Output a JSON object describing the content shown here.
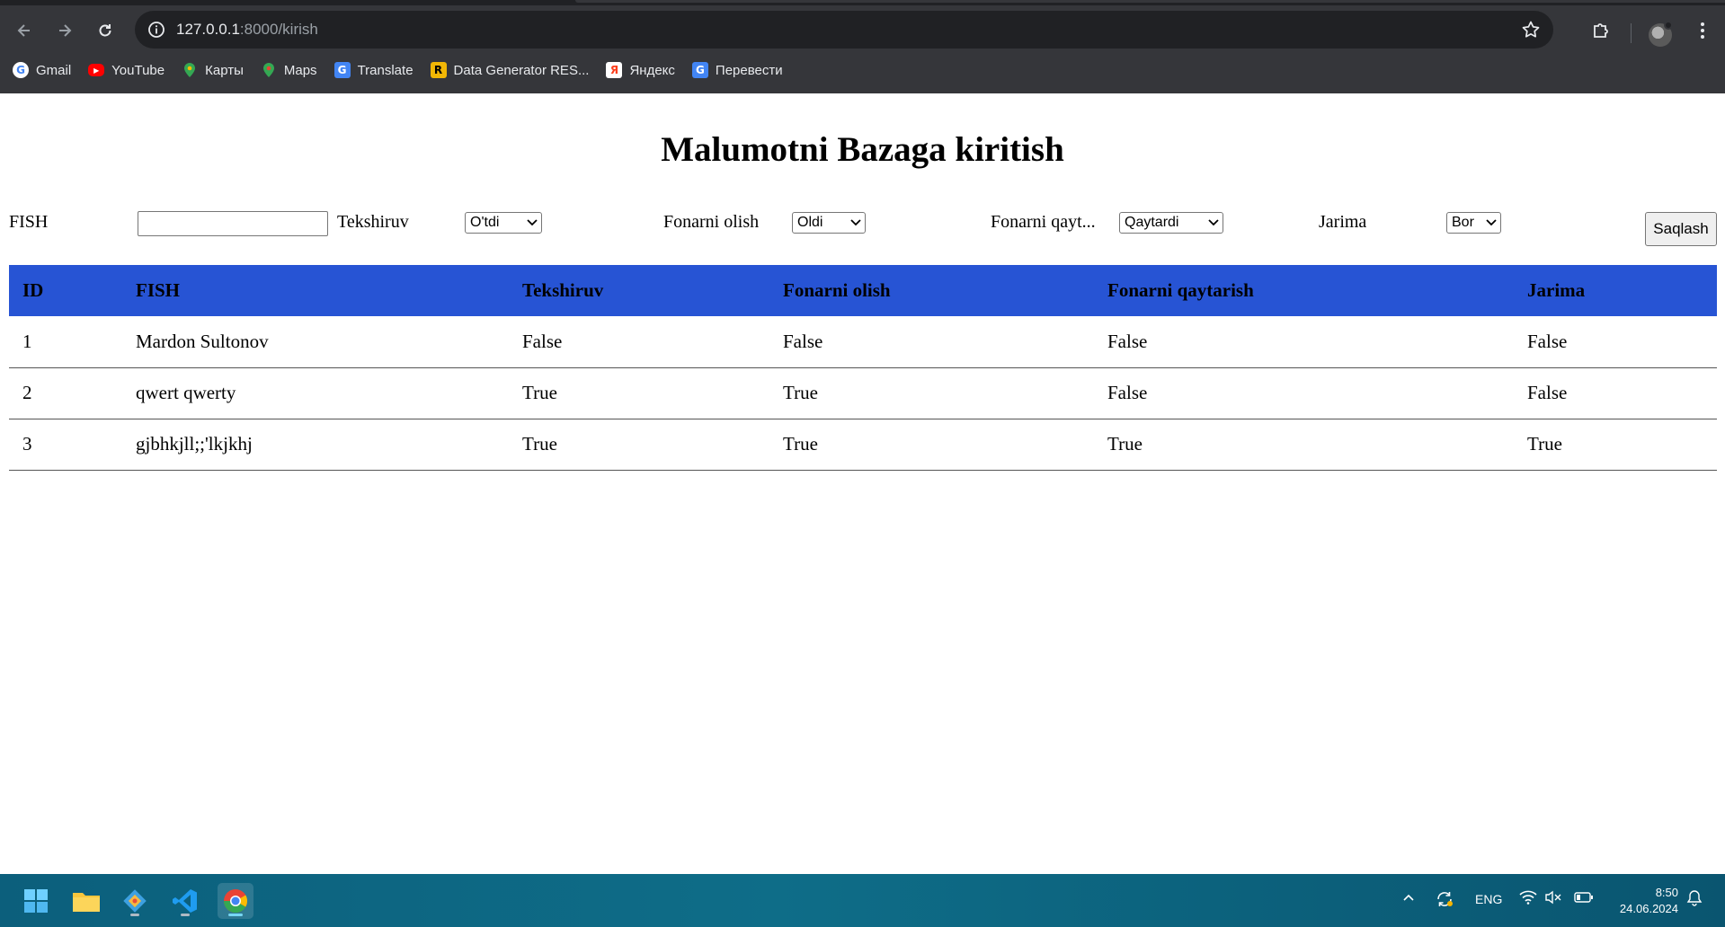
{
  "browser": {
    "url_host": "127.0.0.1",
    "url_path": ":8000/kirish",
    "bookmarks": [
      {
        "label": "Gmail",
        "icon": "google-icon"
      },
      {
        "label": "YouTube",
        "icon": "youtube-icon"
      },
      {
        "label": "Карты",
        "icon": "maps-pin-icon"
      },
      {
        "label": "Maps",
        "icon": "maps-pin-icon"
      },
      {
        "label": "Translate",
        "icon": "translate-icon"
      },
      {
        "label": "Data Generator RES...",
        "icon": "r-logo-icon"
      },
      {
        "label": "Яндекс",
        "icon": "yandex-icon"
      },
      {
        "label": "Перевести",
        "icon": "translate-icon"
      }
    ]
  },
  "page": {
    "title": "Malumotni Bazaga kiritish",
    "form": {
      "fish_label": "FISH",
      "fish_value": "",
      "tekshiruv_label": "Tekshiruv",
      "tekshiruv_selected": "O'tdi",
      "fonarni_olish_label": "Fonarni olish",
      "fonarni_olish_selected": "Oldi",
      "fonarni_qaytarish_label": "Fonarni qayt...",
      "fonarni_qaytarish_selected": "Qaytardi",
      "jarima_label": "Jarima",
      "jarima_selected": "Bor",
      "save_label": "Saqlash"
    },
    "table": {
      "headers": [
        "ID",
        "FISH",
        "Tekshiruv",
        "Fonarni olish",
        "Fonarni qaytarish",
        "Jarima"
      ],
      "rows": [
        [
          "1",
          "Mardon Sultonov",
          "False",
          "False",
          "False",
          "False"
        ],
        [
          "2",
          "qwert qwerty",
          "True",
          "True",
          "False",
          "False"
        ],
        [
          "3",
          "gjbhkjll;;'lkjkhj",
          "True",
          "True",
          "True",
          "True"
        ]
      ]
    }
  },
  "taskbar": {
    "language": "ENG",
    "time": "8:50",
    "date": "24.06.2024",
    "accent": "#76d6f3"
  },
  "colors": {
    "table_header": "#2754d4",
    "chrome_bg": "#35363a"
  }
}
